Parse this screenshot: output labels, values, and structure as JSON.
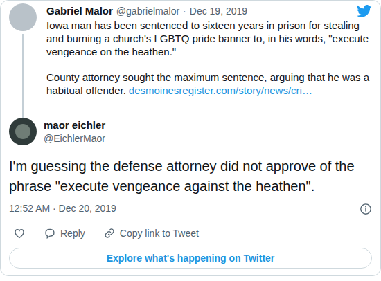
{
  "parent": {
    "author": {
      "name": "Gabriel Malor",
      "handle": "@gabrielmalor",
      "separator": "·",
      "date": "Dec 19, 2019"
    },
    "paragraphs": [
      {
        "text": "Iowa man has been sentenced to sixteen years in prison for stealing and burning a church's LGBTQ pride banner to, in his words, \"execute vengeance on the heathen.\""
      },
      {
        "text": "County attorney sought the maximum sentence, arguing that he was a habitual offender.",
        "link": "desmoinesregister.com/story/news/cri…"
      }
    ]
  },
  "reply": {
    "author": {
      "name": "maor eichler",
      "handle": "@EichlerMaor"
    },
    "text": "I'm guessing the defense attorney did not approve of the phrase \"execute vengeance against the heathen\".",
    "timestamp": "12:52 AM · Dec 20, 2019"
  },
  "actions": [
    {
      "kind": "like",
      "liked": false
    },
    {
      "kind": "reply",
      "label": "Reply"
    },
    {
      "kind": "copy",
      "label": "Copy link to Tweet"
    }
  ],
  "button": {
    "label": "Explore what's happening on Twitter"
  }
}
